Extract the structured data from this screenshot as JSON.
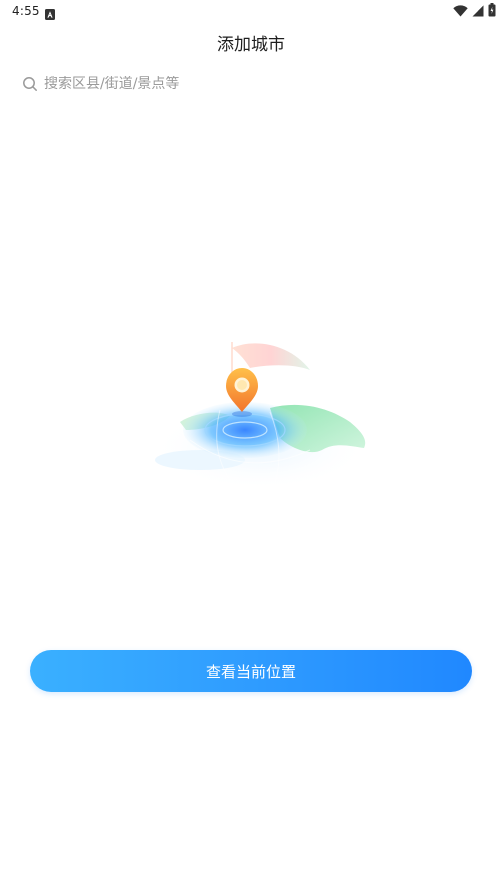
{
  "status_bar": {
    "time": "4:55",
    "notification_icon": "notification-a-icon",
    "wifi_icon": "wifi-icon",
    "signal_icon": "cell-signal-icon",
    "battery_icon": "battery-icon"
  },
  "header": {
    "title": "添加城市"
  },
  "search": {
    "placeholder": "搜索区县/街道/景点等",
    "value": "",
    "icon": "search-icon"
  },
  "illustration": {
    "name": "location-map-illustration",
    "pin_color": "#f5a23a",
    "water_color": "#3aa0ff",
    "land_color": "#7fe0a6"
  },
  "actions": {
    "current_location_label": "查看当前位置"
  },
  "colors": {
    "accent": "#2f9cff",
    "background": "#ffffff"
  }
}
